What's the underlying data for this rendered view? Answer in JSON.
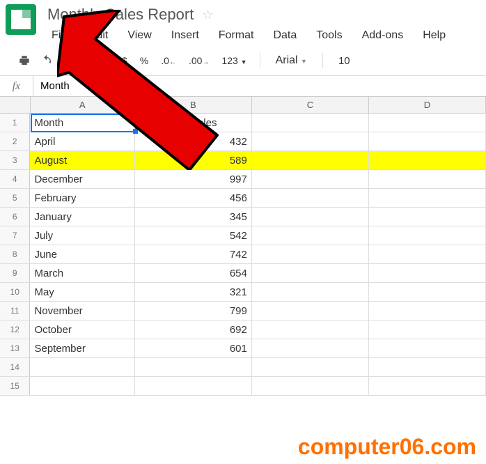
{
  "header": {
    "title": "Monthly Sales Report"
  },
  "menu": {
    "items": [
      "File",
      "Edit",
      "View",
      "Insert",
      "Format",
      "Data",
      "Tools",
      "Add-ons",
      "Help"
    ]
  },
  "toolbar": {
    "currency": "$",
    "percent": "%",
    "dec_dec": ".0",
    "dec_inc": ".00",
    "more_formats": "123",
    "font_name": "Arial",
    "font_size": "10"
  },
  "formula_bar": {
    "fx": "fx",
    "value": "Month"
  },
  "columns": [
    "A",
    "B",
    "C",
    "D"
  ],
  "col_widths": {
    "A": "colA",
    "B": "colB",
    "C": "colC",
    "D": "colD"
  },
  "rows": [
    {
      "n": 1,
      "A": "Month",
      "B": "Number of Sales",
      "B_align": "left"
    },
    {
      "n": 2,
      "A": "April",
      "B": "432"
    },
    {
      "n": 3,
      "A": "August",
      "B": "589",
      "highlight": true
    },
    {
      "n": 4,
      "A": "December",
      "B": "997"
    },
    {
      "n": 5,
      "A": "February",
      "B": "456"
    },
    {
      "n": 6,
      "A": "January",
      "B": "345"
    },
    {
      "n": 7,
      "A": "July",
      "B": "542"
    },
    {
      "n": 8,
      "A": "June",
      "B": "742"
    },
    {
      "n": 9,
      "A": "March",
      "B": "654"
    },
    {
      "n": 10,
      "A": "May",
      "B": "321"
    },
    {
      "n": 11,
      "A": "November",
      "B": "799"
    },
    {
      "n": 12,
      "A": "October",
      "B": "692"
    },
    {
      "n": 13,
      "A": "September",
      "B": "601"
    },
    {
      "n": 14,
      "A": "",
      "B": ""
    },
    {
      "n": 15,
      "A": "",
      "B": ""
    }
  ],
  "active_cell": {
    "row": 1,
    "col": "A"
  },
  "watermark": "computer06.com",
  "chart_data": {
    "type": "table",
    "title": "Monthly Sales Report",
    "columns": [
      "Month",
      "Number of Sales"
    ],
    "rows": [
      [
        "April",
        432
      ],
      [
        "August",
        589
      ],
      [
        "December",
        997
      ],
      [
        "February",
        456
      ],
      [
        "January",
        345
      ],
      [
        "July",
        542
      ],
      [
        "June",
        742
      ],
      [
        "March",
        654
      ],
      [
        "May",
        321
      ],
      [
        "November",
        799
      ],
      [
        "October",
        692
      ],
      [
        "September",
        601
      ]
    ]
  }
}
